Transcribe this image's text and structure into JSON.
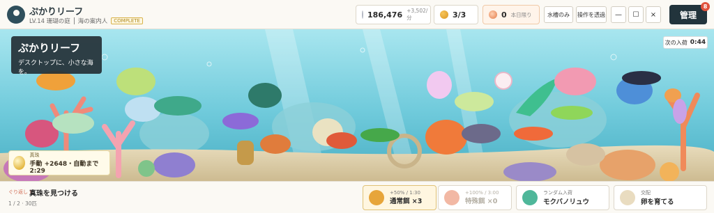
{
  "header": {
    "app_title": "ぷかりリーフ",
    "level": "LV.14 珊瑚の庭",
    "rank": "海の案内人",
    "complete_badge": "COMPLETE",
    "pearls": "186,476",
    "pearl_rate": "+3,502/分",
    "food": "3/3",
    "shells": "0",
    "shells_note": "本日限り",
    "btn_water_only": "水槽のみ",
    "btn_click_through": "操作を透過",
    "btn_minimize": "—",
    "btn_maximize": "☐",
    "btn_close": "×",
    "btn_manage": "管理",
    "manage_count": "8"
  },
  "tank": {
    "title": "ぷかりリーフ",
    "tagline": "デスクトップに、小さな海を。",
    "next_arrival_label": "次の入荷",
    "next_arrival_time": "0:44",
    "pearl_label": "真珠",
    "pearl_status": "手動 +2648・自動まで 2:29"
  },
  "mission": {
    "tag": "ぐり返し 9",
    "title": "真珠を見つける",
    "progress": "1 / 2 · 30匹"
  },
  "cards": [
    {
      "top": "+50% / 1:30",
      "main": "通常餌 ×3",
      "color": "#e7a53a"
    },
    {
      "top": "+100% / 3:00",
      "main": "特殊餌 ×0",
      "color": "#f2b8a4"
    },
    {
      "top": "ランダム入荷",
      "main": "モクバノリュウ",
      "color": "#4fb79a"
    },
    {
      "top": "交配",
      "main": "卵を育てる",
      "color": "#e9dcc0"
    }
  ],
  "colors": {
    "accent_dark": "#22343c",
    "badge_red": "#e0533d",
    "water_top": "#9fe3ee",
    "water_bottom": "#4cb2c7"
  }
}
